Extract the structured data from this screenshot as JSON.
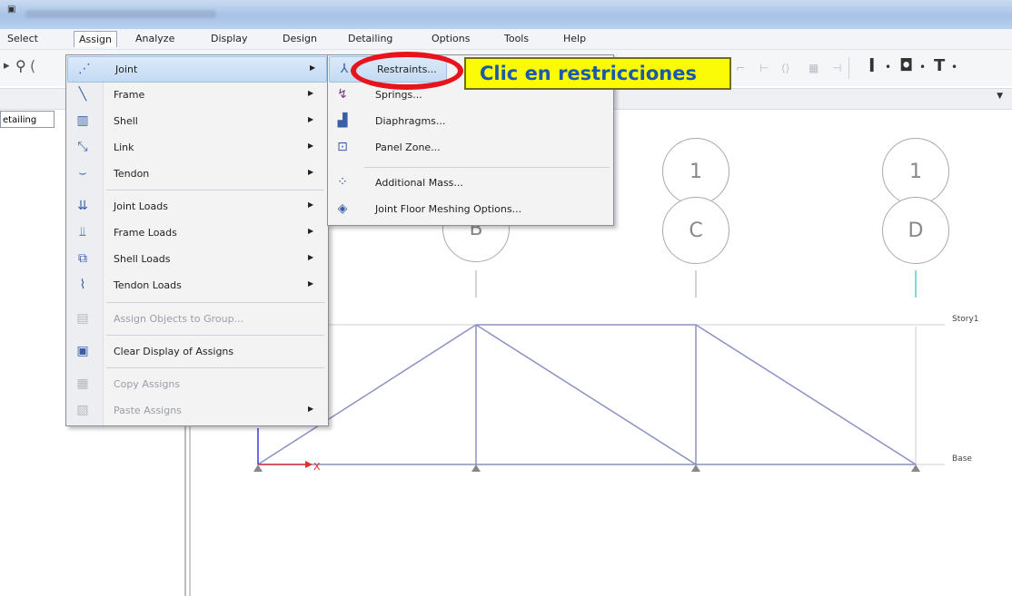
{
  "menubar": {
    "items": [
      "Select",
      "Assign",
      "Analyze",
      "Display",
      "Design",
      "Detailing",
      "Options",
      "Tools",
      "Help"
    ],
    "open_menu": "Assign"
  },
  "panel_tab": "etailing",
  "assign_menu": {
    "items": [
      {
        "label": "Joint",
        "icon": "joint-icon",
        "submenu": true,
        "highlighted": true
      },
      {
        "label": "Frame",
        "icon": "frame-icon",
        "submenu": true
      },
      {
        "label": "Shell",
        "icon": "shell-icon",
        "submenu": true
      },
      {
        "label": "Link",
        "icon": "link-icon",
        "submenu": true
      },
      {
        "label": "Tendon",
        "icon": "tendon-icon",
        "submenu": true
      },
      {
        "label": "Joint Loads",
        "icon": "joint-loads-icon",
        "submenu": true
      },
      {
        "label": "Frame Loads",
        "icon": "frame-loads-icon",
        "submenu": true
      },
      {
        "label": "Shell Loads",
        "icon": "shell-loads-icon",
        "submenu": true
      },
      {
        "label": "Tendon Loads",
        "icon": "tendon-loads-icon",
        "submenu": true
      },
      {
        "label": "Assign Objects to Group...",
        "icon": "group-icon",
        "disabled": true
      },
      {
        "label": "Clear Display of Assigns",
        "icon": "clear-display-icon"
      },
      {
        "label": "Copy Assigns",
        "icon": "copy-icon",
        "disabled": true
      },
      {
        "label": "Paste Assigns",
        "icon": "paste-icon",
        "disabled": true,
        "submenu": true
      }
    ]
  },
  "joint_submenu": {
    "items": [
      {
        "label": "Restraints...",
        "icon": "restraint-icon",
        "highlighted": true
      },
      {
        "label": "Springs...",
        "icon": "spring-icon"
      },
      {
        "label": "Diaphragms...",
        "icon": "diaphragm-icon"
      },
      {
        "label": "Panel Zone...",
        "icon": "panel-zone-icon"
      },
      {
        "label": "Additional Mass...",
        "icon": "mass-icon"
      },
      {
        "label": "Joint Floor Meshing Options...",
        "icon": "mesh-icon"
      }
    ]
  },
  "annotation": {
    "text": "Clic en restricciones",
    "colors": {
      "background": "#fbfb06",
      "text": "#1c5aa8",
      "ellipse": "#e8141c"
    }
  },
  "grid": {
    "bubbles_row1": [
      "1",
      "1"
    ],
    "bubbles_row2": [
      "B",
      "C",
      "D"
    ]
  },
  "story_labels": [
    "Story1",
    "Base"
  ],
  "axis_label": "X"
}
